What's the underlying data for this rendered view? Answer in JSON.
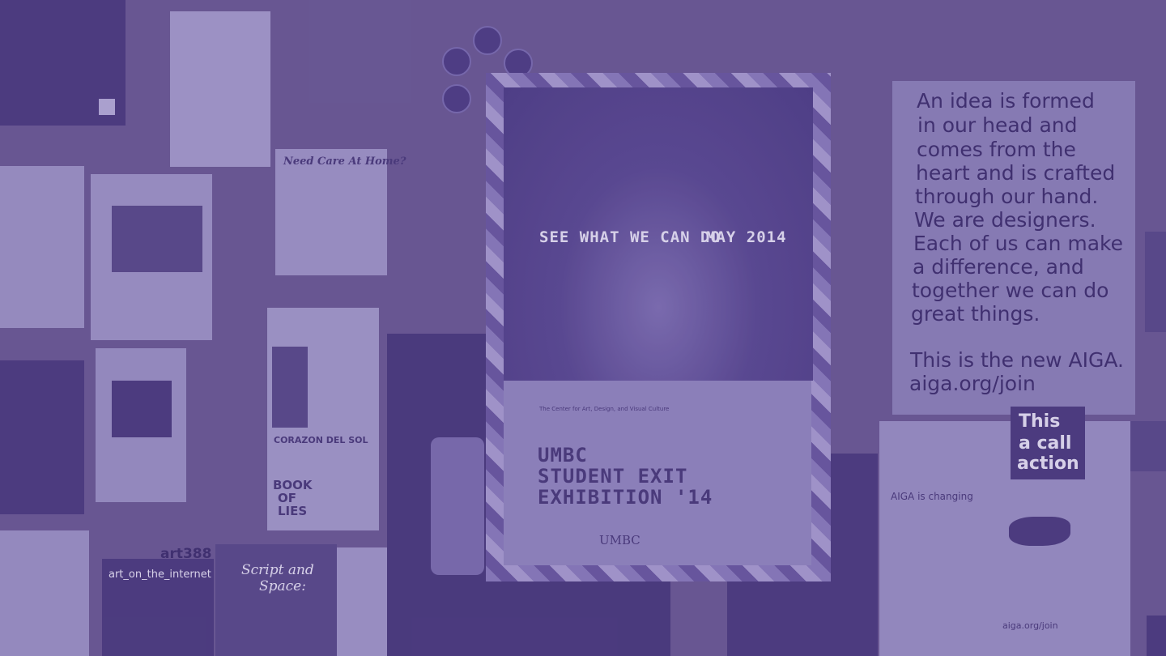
{
  "poster": {
    "tagline": "SEE WHAT WE CAN DO",
    "date": "MAY 2014",
    "org": "The Center for Art, Design, and Visual Culture",
    "title_lines": [
      "UMBC",
      "STUDENT EXIT",
      "EXHIBITION '14"
    ],
    "footer_logo": "UMBC"
  },
  "aiga": {
    "lines": [
      "An idea is formed",
      "in our head and",
      "comes from the",
      "heart and is crafted",
      "through our hand.",
      "We are designers.",
      "Each of us can make",
      "a difference, and",
      "together we can do",
      "great things."
    ],
    "closing": "This is the new AIGA.",
    "url": "aiga.org/join"
  },
  "call": {
    "lines": [
      "This",
      "a call",
      "action"
    ],
    "changing": "AIGA is changing",
    "footer_url": "aiga.org/join"
  },
  "flyers": {
    "care": "Need Care At Home?",
    "corazon": "CORAZON DEL SOL",
    "book": [
      "BOOK",
      "OF",
      "LIES"
    ],
    "art_code": "art388",
    "art_title": "art_on_the_internet",
    "script": [
      "Script and",
      "Space:"
    ]
  },
  "colors": {
    "tint": "#6b5a94",
    "poster_frame": "#8b7cbc",
    "poster_lower": "#9287bf"
  }
}
